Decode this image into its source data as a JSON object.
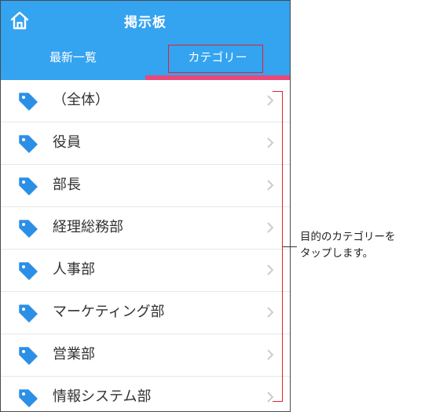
{
  "header": {
    "title": "掲示板",
    "home_icon": "home-icon",
    "background_color": "#34a3f0"
  },
  "tabs": [
    {
      "label": "最新一覧",
      "selected": false
    },
    {
      "label": "カテゴリー",
      "selected": true
    }
  ],
  "tab_underline_color": "#e8497a",
  "highlight_color": "#e0232b",
  "categories": [
    {
      "label": "（全体）",
      "icon": "tag-icon"
    },
    {
      "label": "役員",
      "icon": "tag-icon"
    },
    {
      "label": "部長",
      "icon": "tag-icon"
    },
    {
      "label": "経理総務部",
      "icon": "tag-icon"
    },
    {
      "label": "人事部",
      "icon": "tag-icon"
    },
    {
      "label": "マーケティング部",
      "icon": "tag-icon"
    },
    {
      "label": "営業部",
      "icon": "tag-icon"
    },
    {
      "label": "情報システム部",
      "icon": "tag-icon"
    }
  ],
  "annotation": {
    "line1": "目的のカテゴリーを",
    "line2": "タップします。"
  }
}
